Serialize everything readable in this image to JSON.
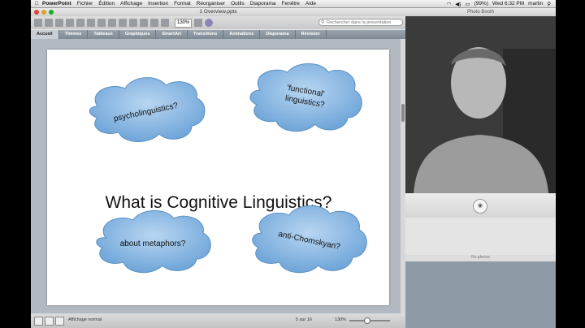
{
  "menubar": {
    "app": "PowerPoint",
    "items": [
      "Fichier",
      "Édition",
      "Affichage",
      "Insertion",
      "Format",
      "Réorganiser",
      "Outils",
      "Diaporama",
      "Fenêtre",
      "Aide"
    ],
    "battery": "(99%)",
    "clock": "Wed 6:32 PM",
    "user": "martin"
  },
  "ppt": {
    "title": "1 Overview.pptx",
    "zoom": "130%",
    "search_placeholder": "Rechercher dans la présentation",
    "ribbon_tabs": [
      "Accueil",
      "Thèmes",
      "Tableaux",
      "Graphiques",
      "SmartArt",
      "Transitions",
      "Animations",
      "Diaporama",
      "Révision"
    ],
    "slide": {
      "heading": "What is Cognitive Linguistics?",
      "clouds": [
        "psycholinguistics?",
        "'functional' linguistics?",
        "about metaphors?",
        "anti-Chomskyan?"
      ]
    },
    "status": {
      "mode": "Affichage normal",
      "pages": "5 sur 16",
      "zoom": "130%"
    }
  },
  "photobooth": {
    "title": "Photo Booth",
    "empty_text": "No photos"
  },
  "colors": {
    "cloud_fill": "#7fb3e0",
    "cloud_stroke": "#5a92c4"
  }
}
